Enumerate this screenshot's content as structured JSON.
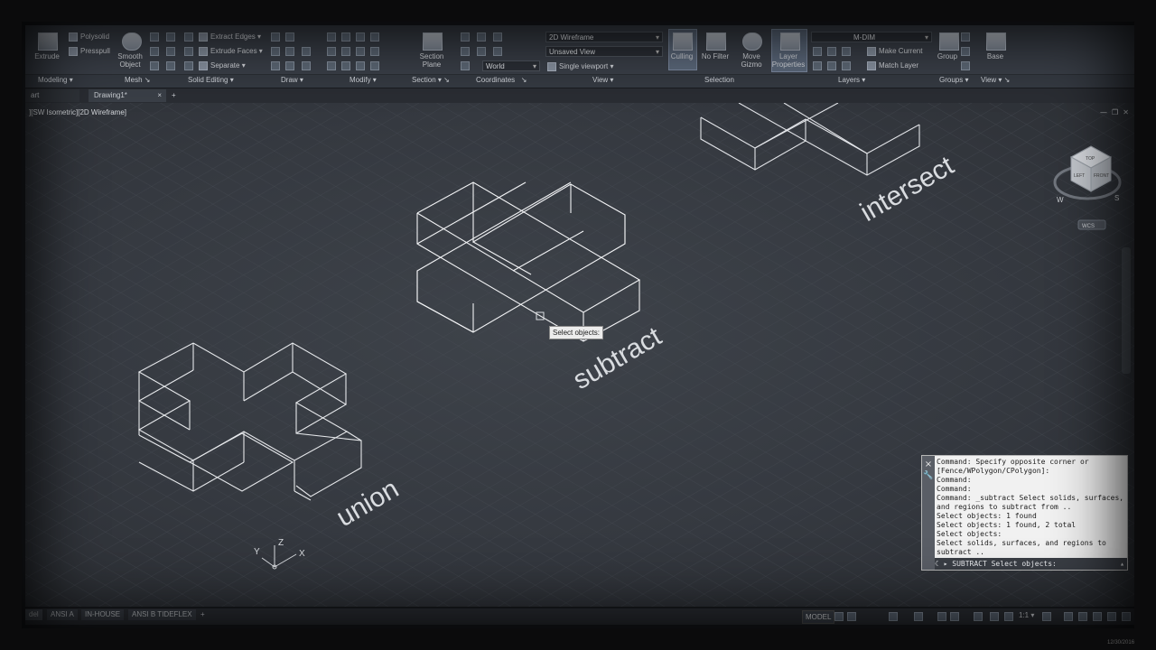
{
  "ribbon": {
    "extrude": "Extrude",
    "polysolid": "Polysolid",
    "presspull": "Presspull",
    "smooth_object": "Smooth\nObject",
    "extract_edges": "Extract Edges",
    "extrude_faces": "Extrude Faces",
    "separate": "Separate",
    "section_plane": "Section\nPlane",
    "visual_style": "2D Wireframe",
    "view": "Unsaved View",
    "ucs": "World",
    "viewport_config": "Single viewport",
    "culling": "Culling",
    "no_filter": "No Filter",
    "move_gizmo": "Move\nGizmo",
    "layer_properties": "Layer\nProperties",
    "layer_name": "M-DIM",
    "make_current": "Make Current",
    "match_layer": "Match Layer",
    "group": "Group",
    "base": "Base"
  },
  "panels": [
    "Modeling",
    "Mesh",
    "Solid Editing",
    "Draw",
    "Modify",
    "Section",
    "Coordinates",
    "View",
    "Selection",
    "Layers",
    "Groups",
    "View"
  ],
  "tabs": {
    "start": "art",
    "drawing": "Drawing1*"
  },
  "viewport": {
    "label": "][SW Isometric][2D Wireframe]",
    "ucs_labels": {
      "x": "X",
      "y": "Y",
      "z": "Z"
    },
    "viewcube": {
      "top": "TOP",
      "left": "LEFT",
      "front": "FRONT",
      "w": "W",
      "s": "S",
      "ucs": "WCS"
    }
  },
  "drawing_labels": {
    "union": "union",
    "subtract": "subtract",
    "intersect": "intersect"
  },
  "tooltip": "Select objects:",
  "command": {
    "history": [
      "Command: Specify opposite corner or [Fence/WPolygon/CPolygon]:",
      "Command:",
      "Command:",
      "Command: _subtract Select solids, surfaces, and regions to subtract from ..",
      "Select objects: 1 found",
      "Select objects: 1 found, 2 total",
      "Select objects:",
      "Select solids, surfaces, and regions to subtract .."
    ],
    "prompt": "SUBTRACT Select objects:"
  },
  "status": {
    "layouts": [
      "del",
      "ANSI A",
      "IN-HOUSE",
      "ANSI B TIDEFLEX"
    ],
    "model": "MODEL",
    "scale": "1:1",
    "date": "12/30/2016"
  },
  "colors": {
    "ribbon": "#3b4049",
    "viewport_bg": "#393d44",
    "wire": "#e8eaed"
  }
}
